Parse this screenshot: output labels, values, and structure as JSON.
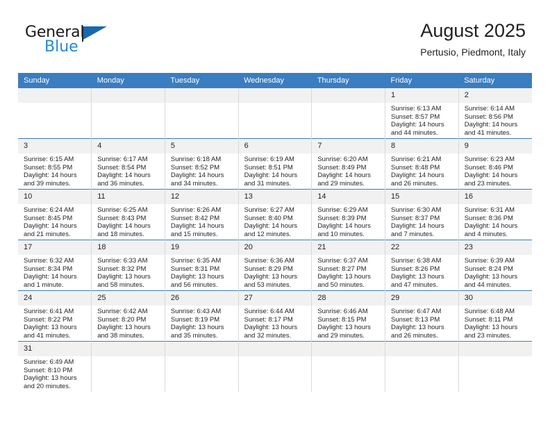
{
  "brand": {
    "name_part1": "General",
    "name_part2": "Blue",
    "flag_color": "#1769b0",
    "blue_color": "#2389d4"
  },
  "header": {
    "title": "August 2025",
    "subtitle": "Pertusio, Piedmont, Italy"
  },
  "theme": {
    "header_row_bg": "#3a7dc0",
    "day_number_bg": "#f1f1f1",
    "row_divider": "#3a7dc0",
    "column_divider": "#d9d9d9",
    "text": "#231f20"
  },
  "weekday_headers": [
    "Sunday",
    "Monday",
    "Tuesday",
    "Wednesday",
    "Thursday",
    "Friday",
    "Saturday"
  ],
  "labels": {
    "sunrise_prefix": "Sunrise:",
    "sunset_prefix": "Sunset:",
    "daylight_prefix": "Daylight:"
  },
  "weeks": [
    [
      {
        "day": "",
        "empty": true
      },
      {
        "day": "",
        "empty": true
      },
      {
        "day": "",
        "empty": true
      },
      {
        "day": "",
        "empty": true
      },
      {
        "day": "",
        "empty": true
      },
      {
        "day": "1",
        "sunrise": "Sunrise: 6:13 AM",
        "sunset": "Sunset: 8:57 PM",
        "daylight1": "Daylight: 14 hours",
        "daylight2": "and 44 minutes."
      },
      {
        "day": "2",
        "sunrise": "Sunrise: 6:14 AM",
        "sunset": "Sunset: 8:56 PM",
        "daylight1": "Daylight: 14 hours",
        "daylight2": "and 41 minutes."
      }
    ],
    [
      {
        "day": "3",
        "sunrise": "Sunrise: 6:15 AM",
        "sunset": "Sunset: 8:55 PM",
        "daylight1": "Daylight: 14 hours",
        "daylight2": "and 39 minutes."
      },
      {
        "day": "4",
        "sunrise": "Sunrise: 6:17 AM",
        "sunset": "Sunset: 8:54 PM",
        "daylight1": "Daylight: 14 hours",
        "daylight2": "and 36 minutes."
      },
      {
        "day": "5",
        "sunrise": "Sunrise: 6:18 AM",
        "sunset": "Sunset: 8:52 PM",
        "daylight1": "Daylight: 14 hours",
        "daylight2": "and 34 minutes."
      },
      {
        "day": "6",
        "sunrise": "Sunrise: 6:19 AM",
        "sunset": "Sunset: 8:51 PM",
        "daylight1": "Daylight: 14 hours",
        "daylight2": "and 31 minutes."
      },
      {
        "day": "7",
        "sunrise": "Sunrise: 6:20 AM",
        "sunset": "Sunset: 8:49 PM",
        "daylight1": "Daylight: 14 hours",
        "daylight2": "and 29 minutes."
      },
      {
        "day": "8",
        "sunrise": "Sunrise: 6:21 AM",
        "sunset": "Sunset: 8:48 PM",
        "daylight1": "Daylight: 14 hours",
        "daylight2": "and 26 minutes."
      },
      {
        "day": "9",
        "sunrise": "Sunrise: 6:23 AM",
        "sunset": "Sunset: 8:46 PM",
        "daylight1": "Daylight: 14 hours",
        "daylight2": "and 23 minutes."
      }
    ],
    [
      {
        "day": "10",
        "sunrise": "Sunrise: 6:24 AM",
        "sunset": "Sunset: 8:45 PM",
        "daylight1": "Daylight: 14 hours",
        "daylight2": "and 21 minutes."
      },
      {
        "day": "11",
        "sunrise": "Sunrise: 6:25 AM",
        "sunset": "Sunset: 8:43 PM",
        "daylight1": "Daylight: 14 hours",
        "daylight2": "and 18 minutes."
      },
      {
        "day": "12",
        "sunrise": "Sunrise: 6:26 AM",
        "sunset": "Sunset: 8:42 PM",
        "daylight1": "Daylight: 14 hours",
        "daylight2": "and 15 minutes."
      },
      {
        "day": "13",
        "sunrise": "Sunrise: 6:27 AM",
        "sunset": "Sunset: 8:40 PM",
        "daylight1": "Daylight: 14 hours",
        "daylight2": "and 12 minutes."
      },
      {
        "day": "14",
        "sunrise": "Sunrise: 6:29 AM",
        "sunset": "Sunset: 8:39 PM",
        "daylight1": "Daylight: 14 hours",
        "daylight2": "and 10 minutes."
      },
      {
        "day": "15",
        "sunrise": "Sunrise: 6:30 AM",
        "sunset": "Sunset: 8:37 PM",
        "daylight1": "Daylight: 14 hours",
        "daylight2": "and 7 minutes."
      },
      {
        "day": "16",
        "sunrise": "Sunrise: 6:31 AM",
        "sunset": "Sunset: 8:36 PM",
        "daylight1": "Daylight: 14 hours",
        "daylight2": "and 4 minutes."
      }
    ],
    [
      {
        "day": "17",
        "sunrise": "Sunrise: 6:32 AM",
        "sunset": "Sunset: 8:34 PM",
        "daylight1": "Daylight: 14 hours",
        "daylight2": "and 1 minute."
      },
      {
        "day": "18",
        "sunrise": "Sunrise: 6:33 AM",
        "sunset": "Sunset: 8:32 PM",
        "daylight1": "Daylight: 13 hours",
        "daylight2": "and 58 minutes."
      },
      {
        "day": "19",
        "sunrise": "Sunrise: 6:35 AM",
        "sunset": "Sunset: 8:31 PM",
        "daylight1": "Daylight: 13 hours",
        "daylight2": "and 56 minutes."
      },
      {
        "day": "20",
        "sunrise": "Sunrise: 6:36 AM",
        "sunset": "Sunset: 8:29 PM",
        "daylight1": "Daylight: 13 hours",
        "daylight2": "and 53 minutes."
      },
      {
        "day": "21",
        "sunrise": "Sunrise: 6:37 AM",
        "sunset": "Sunset: 8:27 PM",
        "daylight1": "Daylight: 13 hours",
        "daylight2": "and 50 minutes."
      },
      {
        "day": "22",
        "sunrise": "Sunrise: 6:38 AM",
        "sunset": "Sunset: 8:26 PM",
        "daylight1": "Daylight: 13 hours",
        "daylight2": "and 47 minutes."
      },
      {
        "day": "23",
        "sunrise": "Sunrise: 6:39 AM",
        "sunset": "Sunset: 8:24 PM",
        "daylight1": "Daylight: 13 hours",
        "daylight2": "and 44 minutes."
      }
    ],
    [
      {
        "day": "24",
        "sunrise": "Sunrise: 6:41 AM",
        "sunset": "Sunset: 8:22 PM",
        "daylight1": "Daylight: 13 hours",
        "daylight2": "and 41 minutes."
      },
      {
        "day": "25",
        "sunrise": "Sunrise: 6:42 AM",
        "sunset": "Sunset: 8:20 PM",
        "daylight1": "Daylight: 13 hours",
        "daylight2": "and 38 minutes."
      },
      {
        "day": "26",
        "sunrise": "Sunrise: 6:43 AM",
        "sunset": "Sunset: 8:19 PM",
        "daylight1": "Daylight: 13 hours",
        "daylight2": "and 35 minutes."
      },
      {
        "day": "27",
        "sunrise": "Sunrise: 6:44 AM",
        "sunset": "Sunset: 8:17 PM",
        "daylight1": "Daylight: 13 hours",
        "daylight2": "and 32 minutes."
      },
      {
        "day": "28",
        "sunrise": "Sunrise: 6:46 AM",
        "sunset": "Sunset: 8:15 PM",
        "daylight1": "Daylight: 13 hours",
        "daylight2": "and 29 minutes."
      },
      {
        "day": "29",
        "sunrise": "Sunrise: 6:47 AM",
        "sunset": "Sunset: 8:13 PM",
        "daylight1": "Daylight: 13 hours",
        "daylight2": "and 26 minutes."
      },
      {
        "day": "30",
        "sunrise": "Sunrise: 6:48 AM",
        "sunset": "Sunset: 8:11 PM",
        "daylight1": "Daylight: 13 hours",
        "daylight2": "and 23 minutes."
      }
    ],
    [
      {
        "day": "31",
        "sunrise": "Sunrise: 6:49 AM",
        "sunset": "Sunset: 8:10 PM",
        "daylight1": "Daylight: 13 hours",
        "daylight2": "and 20 minutes."
      },
      {
        "day": "",
        "empty": true
      },
      {
        "day": "",
        "empty": true
      },
      {
        "day": "",
        "empty": true
      },
      {
        "day": "",
        "empty": true
      },
      {
        "day": "",
        "empty": true
      },
      {
        "day": "",
        "empty": true
      }
    ]
  ]
}
